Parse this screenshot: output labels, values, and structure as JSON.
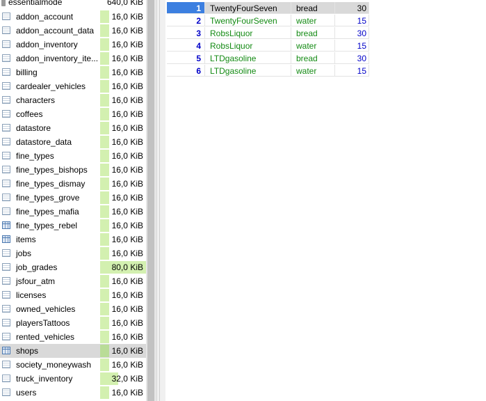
{
  "database": {
    "name": "essentialmode",
    "size": "640,0 KiB"
  },
  "tables": [
    {
      "name": "addon_account",
      "size": "16,0 KiB",
      "icon": "table-icon"
    },
    {
      "name": "addon_account_data",
      "size": "16,0 KiB",
      "icon": "table-icon"
    },
    {
      "name": "addon_inventory",
      "size": "16,0 KiB",
      "icon": "table-icon"
    },
    {
      "name": "addon_inventory_ite...",
      "size": "16,0 KiB",
      "icon": "table-icon"
    },
    {
      "name": "billing",
      "size": "16,0 KiB",
      "icon": "table-icon"
    },
    {
      "name": "cardealer_vehicles",
      "size": "16,0 KiB",
      "icon": "table-icon"
    },
    {
      "name": "characters",
      "size": "16,0 KiB",
      "icon": "table-icon"
    },
    {
      "name": "coffees",
      "size": "16,0 KiB",
      "icon": "table-icon"
    },
    {
      "name": "datastore",
      "size": "16,0 KiB",
      "icon": "table-icon"
    },
    {
      "name": "datastore_data",
      "size": "16,0 KiB",
      "icon": "table-icon"
    },
    {
      "name": "fine_types",
      "size": "16,0 KiB",
      "icon": "table-icon"
    },
    {
      "name": "fine_types_bishops",
      "size": "16,0 KiB",
      "icon": "table-icon"
    },
    {
      "name": "fine_types_dismay",
      "size": "16,0 KiB",
      "icon": "table-icon"
    },
    {
      "name": "fine_types_grove",
      "size": "16,0 KiB",
      "icon": "table-icon"
    },
    {
      "name": "fine_types_mafia",
      "size": "16,0 KiB",
      "icon": "table-icon"
    },
    {
      "name": "fine_types_rebel",
      "size": "16,0 KiB",
      "icon": "table-grid-icon"
    },
    {
      "name": "items",
      "size": "16,0 KiB",
      "icon": "table-grid-icon"
    },
    {
      "name": "jobs",
      "size": "16,0 KiB",
      "icon": "table-icon"
    },
    {
      "name": "job_grades",
      "size": "80,0 KiB",
      "icon": "table-icon"
    },
    {
      "name": "jsfour_atm",
      "size": "16,0 KiB",
      "icon": "table-icon"
    },
    {
      "name": "licenses",
      "size": "16,0 KiB",
      "icon": "table-icon"
    },
    {
      "name": "owned_vehicles",
      "size": "16,0 KiB",
      "icon": "table-icon"
    },
    {
      "name": "playersTattoos",
      "size": "16,0 KiB",
      "icon": "table-icon"
    },
    {
      "name": "rented_vehicles",
      "size": "16,0 KiB",
      "icon": "table-icon"
    },
    {
      "name": "shops",
      "size": "16,0 KiB",
      "icon": "table-grid-icon",
      "selected": true
    },
    {
      "name": "society_moneywash",
      "size": "16,0 KiB",
      "icon": "table-icon"
    },
    {
      "name": "truck_inventory",
      "size": "32,0 KiB",
      "icon": "table-icon"
    },
    {
      "name": "users",
      "size": "16,0 KiB",
      "icon": "table-icon"
    }
  ],
  "grid": {
    "rows": [
      {
        "id": "1",
        "store": "TwentyFourSeven",
        "item": "bread",
        "price": "30",
        "focused": true
      },
      {
        "id": "2",
        "store": "TwentyFourSeven",
        "item": "water",
        "price": "15"
      },
      {
        "id": "3",
        "store": "RobsLiquor",
        "item": "bread",
        "price": "30"
      },
      {
        "id": "4",
        "store": "RobsLiquor",
        "item": "water",
        "price": "15"
      },
      {
        "id": "5",
        "store": "LTDgasoline",
        "item": "bread",
        "price": "30"
      },
      {
        "id": "6",
        "store": "LTDgasoline",
        "item": "water",
        "price": "15"
      }
    ]
  },
  "colors": {
    "id_text": "#0000c8",
    "string_text": "#138a13",
    "selection": "#3c7fe0",
    "size_bar": "#d3f0b0"
  }
}
